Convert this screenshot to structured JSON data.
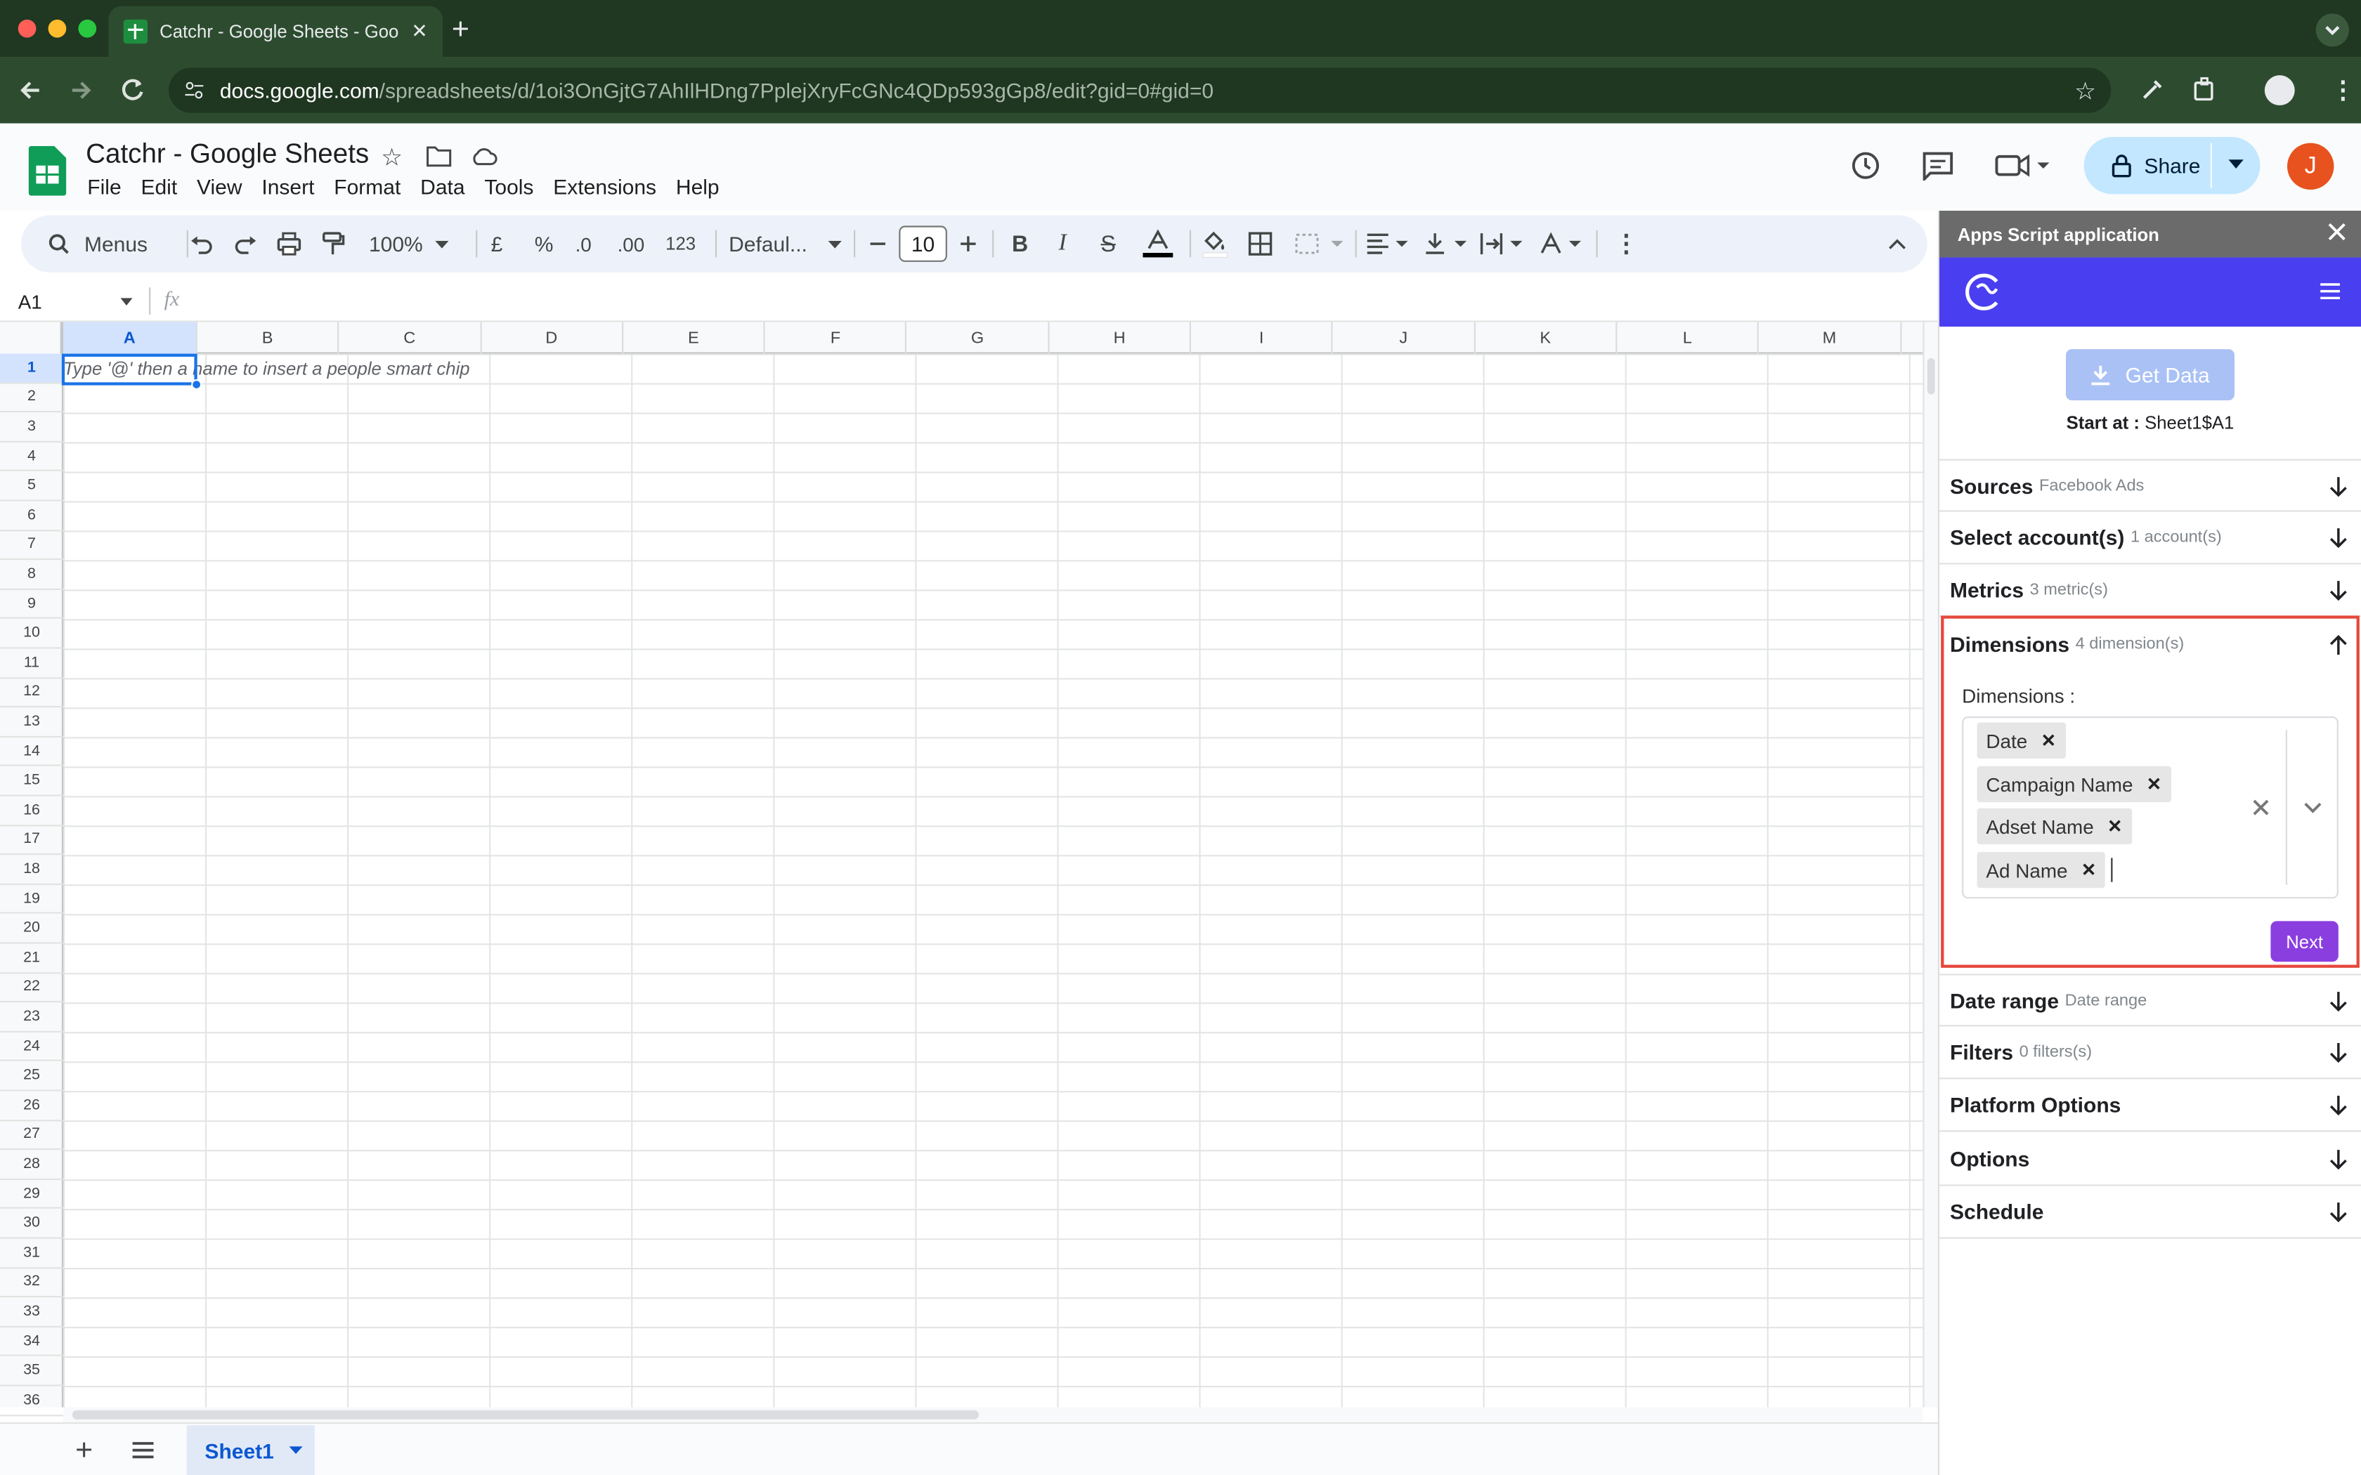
{
  "browser": {
    "tab_title": "Catchr - Google Sheets - Goo",
    "url_domain": "docs.google.com",
    "url_path": "/spreadsheets/d/1oi3OnGjtG7AhIlHDng7PplejXryFcGNc4QDp593gGp8/edit?gid=0#gid=0"
  },
  "doc": {
    "title": "Catchr - Google Sheets",
    "menus": [
      "File",
      "Edit",
      "View",
      "Insert",
      "Format",
      "Data",
      "Tools",
      "Extensions",
      "Help"
    ],
    "share_label": "Share",
    "avatar_letter": "J"
  },
  "toolbar": {
    "menus_search": "Menus",
    "zoom": "100%",
    "currency": "£",
    "percent": "%",
    "dec_less": ".0",
    "dec_more": ".00",
    "number_format": "123",
    "font": "Defaul...",
    "font_size": "10"
  },
  "formula_bar": {
    "cell_ref": "A1",
    "fx": "fx"
  },
  "grid": {
    "columns": [
      "A",
      "B",
      "C",
      "D",
      "E",
      "F",
      "G",
      "H",
      "I",
      "J",
      "K",
      "L",
      "M"
    ],
    "rows": [
      "1",
      "2",
      "3",
      "4",
      "5",
      "6",
      "7",
      "8",
      "9",
      "10",
      "11",
      "12",
      "13",
      "14",
      "15",
      "16",
      "17",
      "18",
      "19",
      "20",
      "21",
      "22",
      "23",
      "24",
      "25",
      "26",
      "27",
      "28",
      "29",
      "30",
      "31",
      "32",
      "33",
      "34",
      "35",
      "36"
    ],
    "cell_hint": "Type '@' then a name to insert a people smart chip"
  },
  "sheets": {
    "active": "Sheet1"
  },
  "panel": {
    "title": "Apps Script application",
    "get_data": "Get Data",
    "start_at_label": "Start at :",
    "start_at_value": "Sheet1$A1",
    "sections": [
      {
        "name": "Sources",
        "sub": "Facebook Ads"
      },
      {
        "name": "Select account(s)",
        "sub": "1 account(s)"
      },
      {
        "name": "Metrics",
        "sub": "3 metric(s)"
      },
      {
        "name": "Dimensions",
        "sub": "4 dimension(s)"
      },
      {
        "name": "Date range",
        "sub": "Date range"
      },
      {
        "name": "Filters",
        "sub": "0 filters(s)"
      },
      {
        "name": "Platform Options",
        "sub": ""
      },
      {
        "name": "Options",
        "sub": ""
      },
      {
        "name": "Schedule",
        "sub": ""
      }
    ],
    "dimensions_label": "Dimensions :",
    "chips": [
      "Date",
      "Campaign Name",
      "Adset Name",
      "Ad Name"
    ],
    "next": "Next"
  },
  "colors": {
    "accent": "#4a3ff0",
    "next": "#8b3ee0",
    "highlight": "#e5483b"
  }
}
